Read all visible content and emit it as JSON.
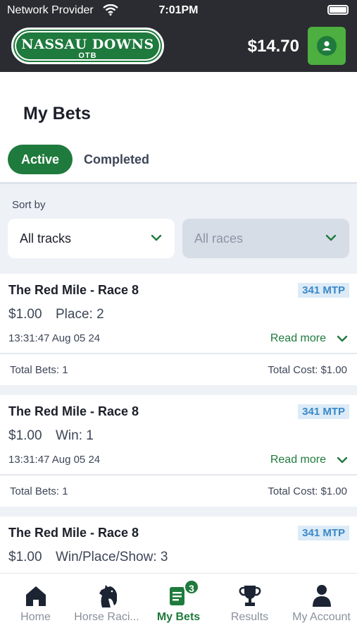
{
  "status_bar": {
    "carrier": "Network Provider",
    "time": "7:01PM"
  },
  "header": {
    "logo_main": "NASSAU DOWNS",
    "logo_sub": "OTB",
    "balance": "$14.70",
    "account_icon": "user-icon"
  },
  "page": {
    "title": "My Bets"
  },
  "tabs": [
    {
      "label": "Active",
      "selected": true
    },
    {
      "label": "Completed",
      "selected": false
    }
  ],
  "sort": {
    "label": "Sort by",
    "tracks_value": "All tracks",
    "races_value": "All races"
  },
  "bets": [
    {
      "track": "The Red Mile - Race 8",
      "mtp": "341 MTP",
      "amount": "$1.00",
      "bet_type": "Place: 2",
      "timestamp": "13:31:47 Aug 05 24",
      "read_more": "Read more",
      "total_bets": "Total Bets: 1",
      "total_cost": "Total Cost: $1.00"
    },
    {
      "track": "The Red Mile - Race 8",
      "mtp": "341 MTP",
      "amount": "$1.00",
      "bet_type": "Win: 1",
      "timestamp": "13:31:47 Aug 05 24",
      "read_more": "Read more",
      "total_bets": "Total Bets: 1",
      "total_cost": "Total Cost: $1.00"
    },
    {
      "track": "The Red Mile - Race 8",
      "mtp": "341 MTP",
      "amount": "$1.00",
      "bet_type": "Win/Place/Show: 3"
    }
  ],
  "nav": [
    {
      "label": "Home",
      "icon": "home-icon"
    },
    {
      "label": "Horse Raci...",
      "icon": "horse-icon"
    },
    {
      "label": "My Bets",
      "icon": "bets-icon",
      "badge": "3",
      "active": true
    },
    {
      "label": "Results",
      "icon": "trophy-icon"
    },
    {
      "label": "My Account",
      "icon": "user-icon"
    }
  ],
  "colors": {
    "brand_green": "#1f7a3d",
    "header_dark": "#2b2c31",
    "mtp_blue": "#3a88c8"
  }
}
